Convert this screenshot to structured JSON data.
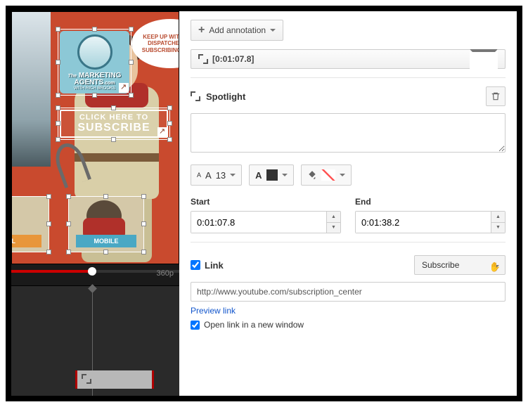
{
  "toolbar": {
    "add_annotation": "Add annotation",
    "timestamp": "[0:01:07.8]"
  },
  "annotation": {
    "type_label": "Spotlight",
    "text_value": ""
  },
  "font": {
    "size": "13"
  },
  "time": {
    "start_label": "Start",
    "start_value": "0:01:07.8",
    "end_label": "End",
    "end_value": "0:01:38.2"
  },
  "link": {
    "label": "Link",
    "checked": true,
    "type": "Subscribe",
    "url": "http://www.youtube.com/subscription_center",
    "preview": "Preview link",
    "open_new": "Open link in a new window",
    "open_new_checked": true
  },
  "player": {
    "quality": "360p"
  },
  "video_overlay": {
    "bubble": "KEEP UP WITH OUR DISPATCHES BY SUBSCRIBING NOW!",
    "logo_line1": "MARKETING",
    "logo_line2": "AGENTS",
    "logo_pre": "The",
    "logo_suf": ".com",
    "logo_sub": "WITH RICH BROOKS",
    "subscribe_line1": "CLICK HERE TO",
    "subscribe_line2": "SUBSCRIBE",
    "card1_label": "AL",
    "card2_label": "MOBILE"
  }
}
